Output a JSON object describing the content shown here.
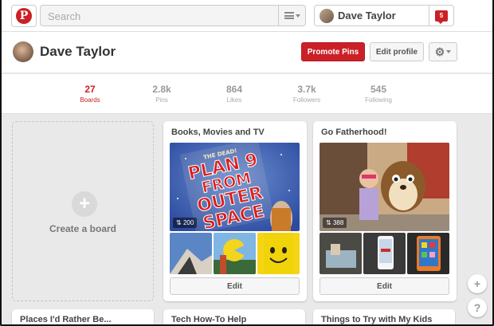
{
  "header": {
    "search_placeholder": "Search",
    "user_name": "Dave Taylor",
    "notification_count": "5"
  },
  "profile": {
    "name": "Dave Taylor",
    "promote_label": "Promote Pins",
    "edit_label": "Edit profile"
  },
  "stats": [
    {
      "num": "27",
      "label": "Boards",
      "active": true
    },
    {
      "num": "2.8k",
      "label": "Pins"
    },
    {
      "num": "864",
      "label": "Likes"
    },
    {
      "num": "3.7k",
      "label": "Followers"
    },
    {
      "num": "545",
      "label": "Following"
    }
  ],
  "create_board_label": "Create a board",
  "boards": [
    {
      "title": "Books, Movies and TV",
      "pin_count": "200",
      "edit_label": "Edit",
      "cover_lines": [
        "THE DEAD!",
        "PLAN 9",
        "FROM",
        "OUTER",
        "SPACE"
      ]
    },
    {
      "title": "Go Fatherhood!",
      "pin_count": "388",
      "edit_label": "Edit"
    }
  ],
  "lower_boards": [
    {
      "title": "Places I'd Rather Be..."
    },
    {
      "title": "Tech How-To Help"
    },
    {
      "title": "Things to Try with My Kids"
    }
  ],
  "colors": {
    "accent": "#cb2027",
    "background": "#e9e9e9"
  },
  "icons": [
    "pinterest-logo-icon",
    "menu-icon",
    "notification-icon",
    "gear-icon",
    "plus-icon",
    "help-icon",
    "pin-icon"
  ]
}
